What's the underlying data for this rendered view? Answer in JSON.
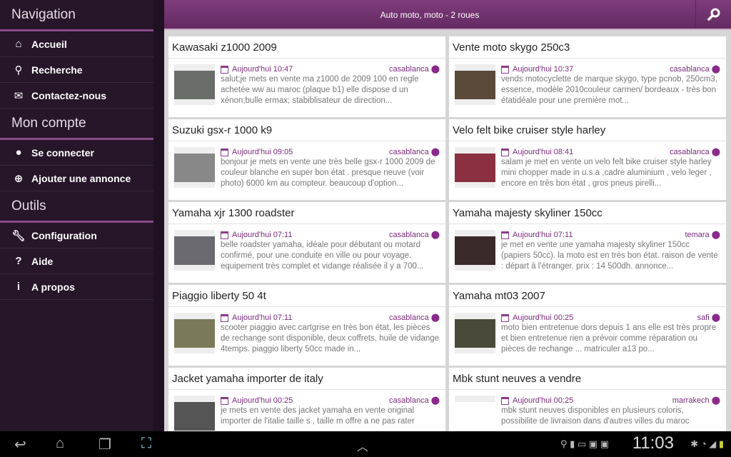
{
  "sidebar": {
    "sections": [
      {
        "title": "Navigation",
        "items": [
          {
            "label": "Accueil",
            "icon": "home-icon"
          },
          {
            "label": "Recherche",
            "icon": "search-icon"
          },
          {
            "label": "Contactez-nous",
            "icon": "mail-icon"
          }
        ]
      },
      {
        "title": "Mon compte",
        "items": [
          {
            "label": "Se connecter",
            "icon": "user-icon"
          },
          {
            "label": "Ajouter une annonce",
            "icon": "plus-circle-icon"
          }
        ]
      },
      {
        "title": "Outils",
        "items": [
          {
            "label": "Configuration",
            "icon": "wrench-icon"
          },
          {
            "label": "Aide",
            "icon": "help-icon"
          },
          {
            "label": "A propos",
            "icon": "info-icon"
          }
        ]
      }
    ]
  },
  "header": {
    "title": "Auto moto, moto - 2 roues"
  },
  "listings": [
    {
      "title": "Kawasaki z1000 2009",
      "date": "Aujourd'hui 10:47",
      "city": "casablanca",
      "desc": "salut;je mets en vente ma z1000 de 2009 100 en regle achetée ww au maroc (plaque b1) elle dispose d un xénon;bulle ermax; stabiblisateur de direction..."
    },
    {
      "title": "Vente moto skygo 250c3",
      "date": "Aujourd'hui 10:37",
      "city": "casablanca",
      "desc": "vends motocyclette de marque skygo, type pcnob, 250cm3, essence, modèle 2010couleur carmen/ bordeaux - très bon étatidéale pour une première mot..."
    },
    {
      "title": "Suzuki gsx-r 1000 k9",
      "date": "Aujourd'hui 09:05",
      "city": "casablanca",
      "desc": "bonjour je mets en vente une très belle gsx-r 1000 2009 de couleur blanche en super bon état . presque neuve (voir photo) 6000 km au compteur. beaucoup d'option..."
    },
    {
      "title": "Velo felt bike cruiser style harley",
      "date": "Aujourd'hui 08:41",
      "city": "casablanca",
      "desc": "salam je met en vente un velo felt bike cruiser style harley mini chopper made in u.s.a ,cadre aluminium , velo leger , encore en très bon état , gros pneus pirelli..."
    },
    {
      "title": "Yamaha xjr 1300 roadster",
      "date": "Aujourd'hui 07:11",
      "city": "casablanca",
      "desc": "belle roadster yamaha, idéale pour débutant ou motard confirmé, pour une conduite en ville ou pour voyage. equipement très complet et vidange réalisée il y a 700..."
    },
    {
      "title": "Yamaha majesty skyliner 150cc",
      "date": "Aujourd'hui 07:11",
      "city": "temara",
      "desc": "je met en vente une yamaha majesty skyliner 150cc (papiers 50cc). la moto est en très bon état. raison de vente : départ à l'étranger. prix : 14 500dh. annonce..."
    },
    {
      "title": "Piaggio liberty 50 4t",
      "date": "Aujourd'hui 07:11",
      "city": "casablanca",
      "desc": "scooter piaggio avec cartgrise en très bon état, les pièces de rechange sont disponible, deux coffrets, huile de vidange 4temps. piaggio liberty 50cc made in..."
    },
    {
      "title": "Yamaha mt03 2007",
      "date": "Aujourd'hui 00:25",
      "city": "safi",
      "desc": "moto bien entretenue dors depuis 1 ans elle est très propre et bien entretenue rien a prévoir comme réparation ou pièces de rechange ... matriculer a13 po..."
    },
    {
      "title": "Jacket yamaha importer de italy",
      "date": "Aujourd'hui 00:25",
      "city": "casablanca",
      "desc": "je mets en vente des jacket yamaha en vente original importer de l'italie taille s , taille m offre a ne pas rater"
    },
    {
      "title": "Mbk stunt neuves a vendre",
      "date": "Aujourd'hui 00:25",
      "city": "marrakech",
      "desc": "mbk stunt neuves disponibles en plusieurs coloris, possibilite de livraison dans d'autres villes du maroc"
    }
  ],
  "statusbar": {
    "time": "11:03"
  },
  "colors": {
    "accent": "#7a2a7a",
    "sidebar": "#27152a",
    "header": "#713470"
  }
}
